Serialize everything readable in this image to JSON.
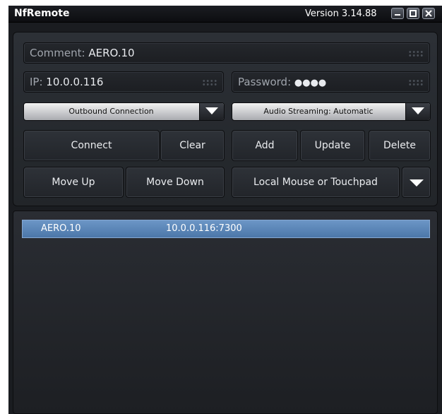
{
  "window": {
    "title": "NfRemote",
    "version": "Version 3.14.88",
    "controls": [
      "minimize-icon",
      "maximize-icon",
      "close-icon"
    ]
  },
  "form": {
    "comment_label": "Comment: ",
    "comment_value": "AERO.10",
    "ip_label": "IP: ",
    "ip_value": "10.0.0.116",
    "password_label": "Password: ",
    "password_value": "●●●●",
    "connection_type": "Outbound Connection",
    "audio_streaming": "Audio Streaming: Automatic"
  },
  "buttons": {
    "connect": "Connect",
    "clear": "Clear",
    "add": "Add",
    "update": "Update",
    "delete": "Delete",
    "move_up": "Move Up",
    "move_down": "Move Down",
    "input_mode": "Local Mouse or Touchpad"
  },
  "list": {
    "rows": [
      {
        "name": "AERO.10",
        "address": "10.0.0.116:7300",
        "selected": true
      }
    ]
  },
  "colors": {
    "window_bg": "#1a1c20",
    "selection": "#5a84b6",
    "text": "#eaecef"
  }
}
